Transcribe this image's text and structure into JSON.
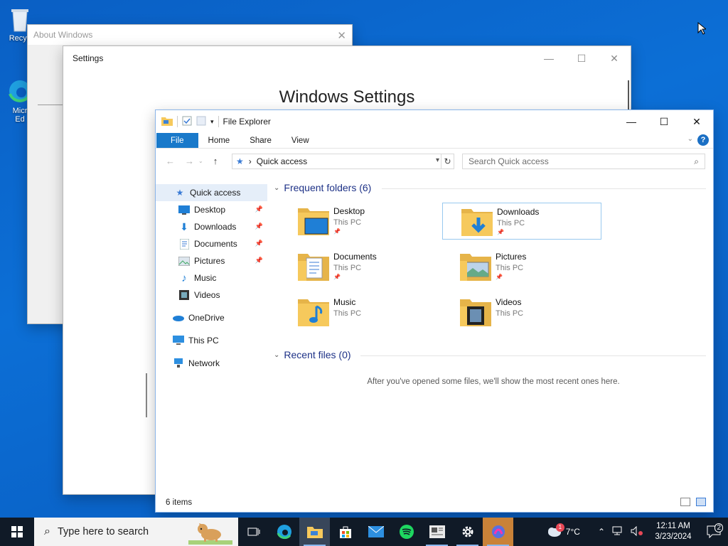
{
  "desktop": {
    "icons": [
      {
        "label": "Recyc",
        "icon": "recycle-bin-icon"
      },
      {
        "label": "Micr\nEd",
        "icon": "edge-icon"
      }
    ]
  },
  "about_window": {
    "title": "About Windows",
    "close": "✕"
  },
  "settings_window": {
    "title": "Settings",
    "heading": "Windows Settings",
    "minimize": "—",
    "maximize": "☐",
    "close": "✕"
  },
  "explorer": {
    "title": "File Explorer",
    "minimize": "—",
    "maximize": "☐",
    "close": "✕",
    "ribbon_tabs": [
      "File",
      "Home",
      "Share",
      "View"
    ],
    "help": "?",
    "address": "Quick access",
    "address_separator": "›",
    "search_placeholder": "Search Quick access",
    "nav_items": [
      {
        "label": "Quick access",
        "icon": "star-icon",
        "selected": true,
        "pinned": false,
        "indent": 0
      },
      {
        "label": "Desktop",
        "icon": "desktop-icon",
        "pinned": true,
        "indent": 1
      },
      {
        "label": "Downloads",
        "icon": "download-icon",
        "pinned": true,
        "indent": 1
      },
      {
        "label": "Documents",
        "icon": "document-icon",
        "pinned": true,
        "indent": 1
      },
      {
        "label": "Pictures",
        "icon": "picture-icon",
        "pinned": true,
        "indent": 1
      },
      {
        "label": "Music",
        "icon": "music-icon",
        "pinned": false,
        "indent": 1
      },
      {
        "label": "Videos",
        "icon": "video-icon",
        "pinned": false,
        "indent": 1
      },
      {
        "label": "OneDrive",
        "icon": "onedrive-icon",
        "pinned": false,
        "indent": 0
      },
      {
        "label": "This PC",
        "icon": "pc-icon",
        "pinned": false,
        "indent": 0
      },
      {
        "label": "Network",
        "icon": "network-icon",
        "pinned": false,
        "indent": 0
      }
    ],
    "frequent_header": "Frequent folders (6)",
    "recent_header": "Recent files (0)",
    "folders": [
      {
        "name": "Desktop",
        "location": "This PC",
        "pinned": true,
        "overlay": "desktop"
      },
      {
        "name": "Downloads",
        "location": "This PC",
        "pinned": true,
        "overlay": "download",
        "selected": true
      },
      {
        "name": "Documents",
        "location": "This PC",
        "pinned": true,
        "overlay": "document"
      },
      {
        "name": "Pictures",
        "location": "This PC",
        "pinned": true,
        "overlay": "picture"
      },
      {
        "name": "Music",
        "location": "This PC",
        "pinned": false,
        "overlay": "music"
      },
      {
        "name": "Videos",
        "location": "This PC",
        "pinned": false,
        "overlay": "video"
      }
    ],
    "empty_message": "After you've opened some files, we'll show the most recent ones here.",
    "status": "6 items"
  },
  "taskbar": {
    "search_placeholder": "Type here to search",
    "apps": [
      "task-view-icon",
      "edge-icon",
      "file-explorer-icon",
      "store-icon",
      "mail-icon",
      "spotify-icon",
      "news-icon",
      "settings-icon",
      "copilot-icon"
    ],
    "weather": "7°C",
    "weather_badge": "1",
    "time": "12:11 AM",
    "date": "3/23/2024",
    "notifications": "2"
  },
  "colors": {
    "accent": "#1979ca",
    "folder": "#f6c95c",
    "taskbar": "#101a27"
  }
}
